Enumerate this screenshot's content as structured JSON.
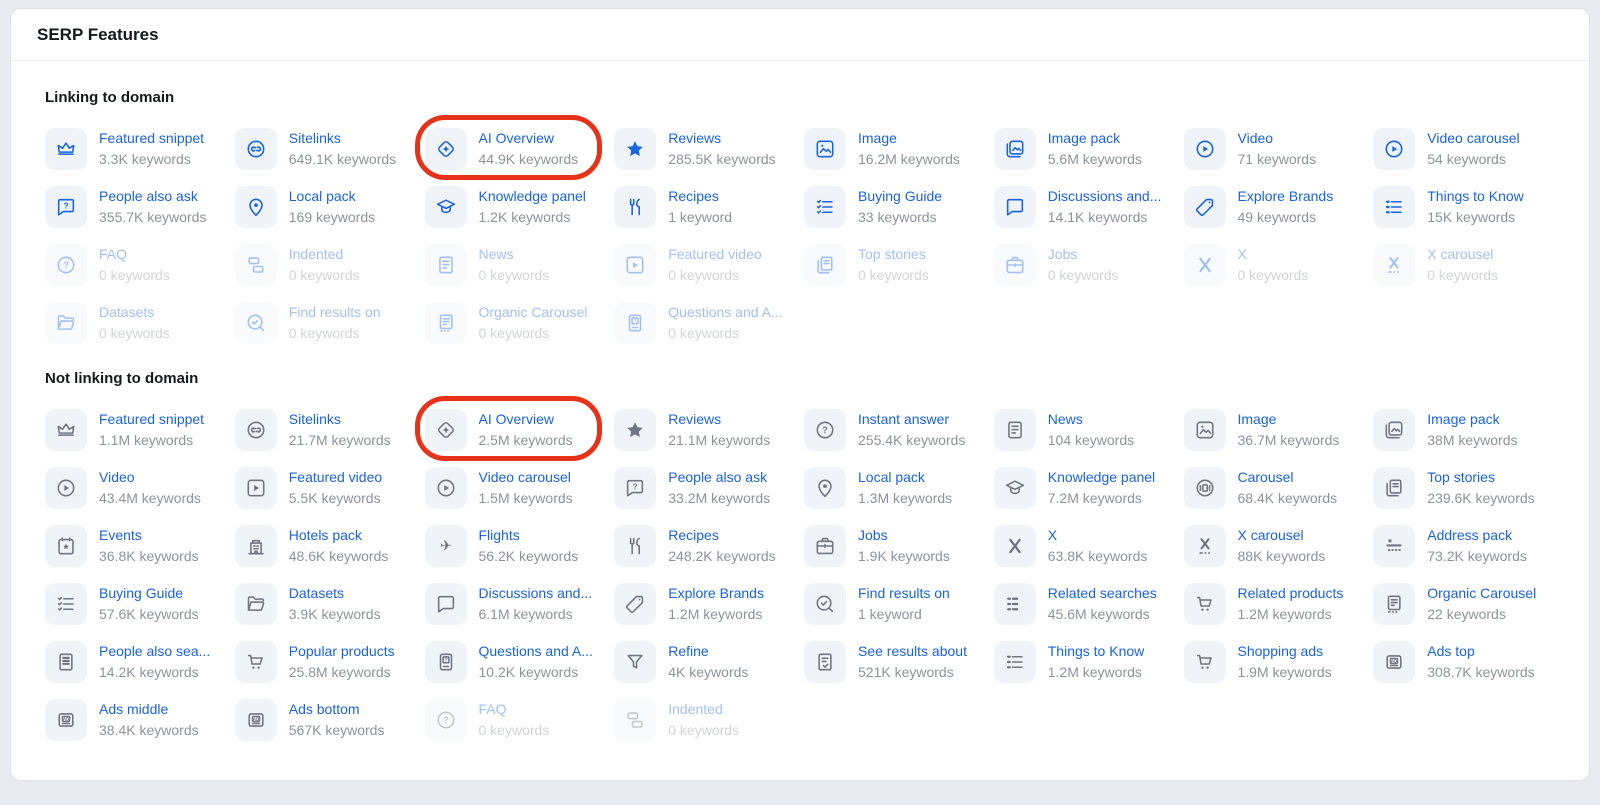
{
  "header": {
    "title": "SERP Features"
  },
  "colors": {
    "link_blue": "#1a63e3",
    "icon_blue": "#1765df",
    "icon_gray": "#6f7681",
    "count_gray": "#8d939d",
    "tile_background": "#f0f3f8",
    "highlight_red": "#e73119"
  },
  "sections": [
    {
      "title": "Linking to domain",
      "icon_style": "blue",
      "items": [
        {
          "label": "Featured snippet",
          "count": "3.3K keywords",
          "icon": "crown"
        },
        {
          "label": "Sitelinks",
          "count": "649.1K keywords",
          "icon": "link"
        },
        {
          "label": "AI Overview",
          "count": "44.9K keywords",
          "icon": "ai-overview",
          "highlighted": true
        },
        {
          "label": "Reviews",
          "count": "285.5K keywords",
          "icon": "star"
        },
        {
          "label": "Image",
          "count": "16.2M keywords",
          "icon": "image"
        },
        {
          "label": "Image pack",
          "count": "5.6M keywords",
          "icon": "image-pack"
        },
        {
          "label": "Video",
          "count": "71 keywords",
          "icon": "play-circle"
        },
        {
          "label": "Video carousel",
          "count": "54 keywords",
          "icon": "play-circle"
        },
        {
          "label": "People also ask",
          "count": "355.7K keywords",
          "icon": "speech-question"
        },
        {
          "label": "Local pack",
          "count": "169 keywords",
          "icon": "location-pin"
        },
        {
          "label": "Knowledge panel",
          "count": "1.2K keywords",
          "icon": "graduation-cap"
        },
        {
          "label": "Recipes",
          "count": "1 keyword",
          "icon": "cutlery"
        },
        {
          "label": "Buying Guide",
          "count": "33 keywords",
          "icon": "checklist"
        },
        {
          "label": "Discussions and...",
          "count": "14.1K keywords",
          "icon": "speech-bubble"
        },
        {
          "label": "Explore Brands",
          "count": "49 keywords",
          "icon": "tag"
        },
        {
          "label": "Things to Know",
          "count": "15K keywords",
          "icon": "list"
        },
        {
          "label": "FAQ",
          "count": "0 keywords",
          "icon": "question-circle",
          "disabled": true
        },
        {
          "label": "Indented",
          "count": "0 keywords",
          "icon": "indented",
          "disabled": true
        },
        {
          "label": "News",
          "count": "0 keywords",
          "icon": "news",
          "disabled": true
        },
        {
          "label": "Featured video",
          "count": "0 keywords",
          "icon": "play-square",
          "disabled": true
        },
        {
          "label": "Top stories",
          "count": "0 keywords",
          "icon": "top-stories",
          "disabled": true
        },
        {
          "label": "Jobs",
          "count": "0 keywords",
          "icon": "briefcase",
          "disabled": true
        },
        {
          "label": "X",
          "count": "0 keywords",
          "icon": "x-logo",
          "disabled": true
        },
        {
          "label": "X carousel",
          "count": "0 keywords",
          "icon": "x-carousel",
          "disabled": true
        },
        {
          "label": "Datasets",
          "count": "0 keywords",
          "icon": "folder",
          "disabled": true
        },
        {
          "label": "Find results on",
          "count": "0 keywords",
          "icon": "search-check",
          "disabled": true
        },
        {
          "label": "Organic Carousel",
          "count": "0 keywords",
          "icon": "organic-carousel",
          "disabled": true
        },
        {
          "label": "Questions and A...",
          "count": "0 keywords",
          "icon": "question-book",
          "disabled": true
        }
      ]
    },
    {
      "title": "Not linking to domain",
      "icon_style": "gray",
      "items": [
        {
          "label": "Featured snippet",
          "count": "1.1M keywords",
          "icon": "crown"
        },
        {
          "label": "Sitelinks",
          "count": "21.7M keywords",
          "icon": "link"
        },
        {
          "label": "AI Overview",
          "count": "2.5M keywords",
          "icon": "ai-overview",
          "highlighted": true
        },
        {
          "label": "Reviews",
          "count": "21.1M keywords",
          "icon": "star"
        },
        {
          "label": "Instant answer",
          "count": "255.4K keywords",
          "icon": "question-circle"
        },
        {
          "label": "News",
          "count": "104 keywords",
          "icon": "news"
        },
        {
          "label": "Image",
          "count": "36.7M keywords",
          "icon": "image"
        },
        {
          "label": "Image pack",
          "count": "38M keywords",
          "icon": "image-pack"
        },
        {
          "label": "Video",
          "count": "43.4M keywords",
          "icon": "play-circle"
        },
        {
          "label": "Featured video",
          "count": "5.5K keywords",
          "icon": "play-square"
        },
        {
          "label": "Video carousel",
          "count": "1.5M keywords",
          "icon": "play-circle"
        },
        {
          "label": "People also ask",
          "count": "33.2M keywords",
          "icon": "speech-question"
        },
        {
          "label": "Local pack",
          "count": "1.3M keywords",
          "icon": "location-pin"
        },
        {
          "label": "Knowledge panel",
          "count": "7.2M keywords",
          "icon": "graduation-cap"
        },
        {
          "label": "Carousel",
          "count": "68.4K keywords",
          "icon": "carousel"
        },
        {
          "label": "Top stories",
          "count": "239.6K keywords",
          "icon": "top-stories"
        },
        {
          "label": "Events",
          "count": "36.8K keywords",
          "icon": "calendar-star"
        },
        {
          "label": "Hotels pack",
          "count": "48.6K keywords",
          "icon": "building"
        },
        {
          "label": "Flights",
          "count": "56.2K keywords",
          "icon": "plane"
        },
        {
          "label": "Recipes",
          "count": "248.2K keywords",
          "icon": "cutlery"
        },
        {
          "label": "Jobs",
          "count": "1.9K keywords",
          "icon": "briefcase"
        },
        {
          "label": "X",
          "count": "63.8K keywords",
          "icon": "x-logo"
        },
        {
          "label": "X carousel",
          "count": "88K keywords",
          "icon": "x-carousel"
        },
        {
          "label": "Address pack",
          "count": "73.2K keywords",
          "icon": "address-pack"
        },
        {
          "label": "Buying Guide",
          "count": "57.6K keywords",
          "icon": "checklist"
        },
        {
          "label": "Datasets",
          "count": "3.9K keywords",
          "icon": "folder"
        },
        {
          "label": "Discussions and...",
          "count": "6.1M keywords",
          "icon": "speech-bubble"
        },
        {
          "label": "Explore Brands",
          "count": "1.2M keywords",
          "icon": "tag"
        },
        {
          "label": "Find results on",
          "count": "1 keyword",
          "icon": "search-check"
        },
        {
          "label": "Related searches",
          "count": "45.6M keywords",
          "icon": "related-searches"
        },
        {
          "label": "Related products",
          "count": "1.2M keywords",
          "icon": "cart"
        },
        {
          "label": "Organic Carousel",
          "count": "22 keywords",
          "icon": "organic-carousel"
        },
        {
          "label": "People also sea...",
          "count": "14.2K keywords",
          "icon": "doc-lines"
        },
        {
          "label": "Popular products",
          "count": "25.8M keywords",
          "icon": "cart"
        },
        {
          "label": "Questions and A...",
          "count": "10.2K keywords",
          "icon": "question-book"
        },
        {
          "label": "Refine",
          "count": "4K keywords",
          "icon": "funnel"
        },
        {
          "label": "See results about",
          "count": "521K keywords",
          "icon": "doc-check"
        },
        {
          "label": "Things to Know",
          "count": "1.2M keywords",
          "icon": "list"
        },
        {
          "label": "Shopping ads",
          "count": "1.9M keywords",
          "icon": "cart"
        },
        {
          "label": "Ads top",
          "count": "308.7K keywords",
          "icon": "ad-box"
        },
        {
          "label": "Ads middle",
          "count": "38.4K keywords",
          "icon": "ad-box"
        },
        {
          "label": "Ads bottom",
          "count": "567K keywords",
          "icon": "ad-box"
        },
        {
          "label": "FAQ",
          "count": "0 keywords",
          "icon": "question-circle",
          "disabled": true
        },
        {
          "label": "Indented",
          "count": "0 keywords",
          "icon": "indented",
          "disabled": true
        }
      ]
    }
  ]
}
